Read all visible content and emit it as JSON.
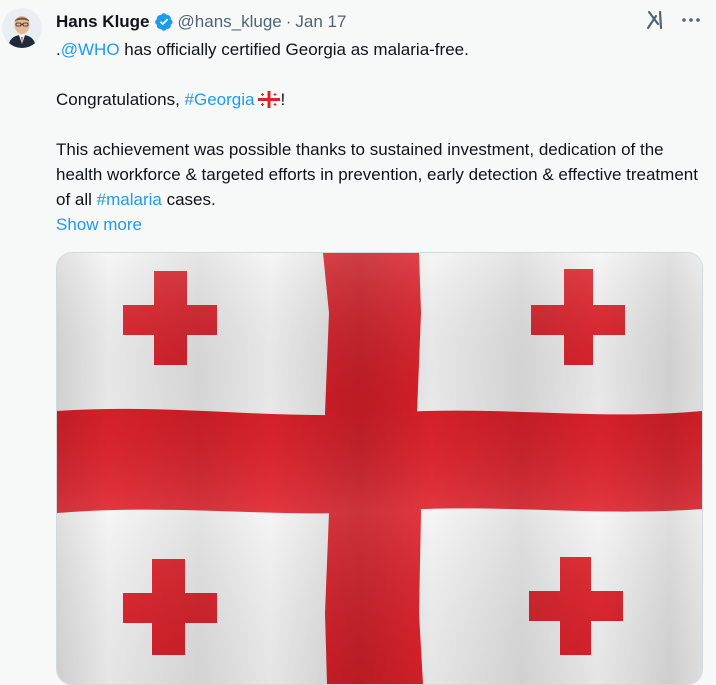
{
  "tweet": {
    "author_name": "Hans Kluge",
    "handle": "@hans_kluge",
    "separator": "·",
    "date": "Jan 17",
    "text": {
      "line1_prefix": ".",
      "line1_mention": "@WHO",
      "line1_rest": " has officially certified Georgia as malaria-free.",
      "line2_prefix": "Congratulations, ",
      "line2_hashtag": "#Georgia",
      "line2_suffix": "!",
      "line3_part1": "This achievement was possible thanks to sustained investment, dedication of the health workforce & targeted efforts in prevention, early detection & effective treatment of all ",
      "line3_hashtag": "#malaria",
      "line3_part2": " cases.",
      "show_more": "Show more"
    }
  },
  "icons": {
    "verified": "verified-badge-icon",
    "grok": "grok-icon",
    "more": "more-options-icon",
    "flag_emoji": "georgia-flag-icon"
  },
  "colors": {
    "link": "#1d9bf0",
    "flag_red": "#e0202a",
    "text": "#0f1419",
    "muted": "#536471"
  }
}
